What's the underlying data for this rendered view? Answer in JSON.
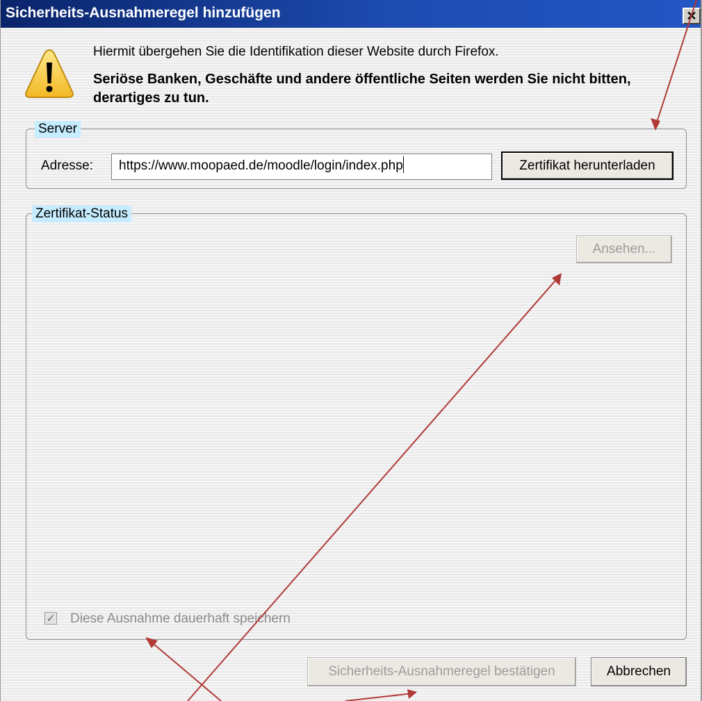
{
  "window": {
    "title": "Sicherheits-Ausnahmeregel hinzufügen",
    "close_glyph": "✕"
  },
  "warning": {
    "icon": "warning-icon",
    "line1": "Hiermit übergehen Sie die Identifikation dieser Website durch Firefox.",
    "line2": "Seriöse Banken, Geschäfte und andere öffentliche Seiten werden Sie nicht bitten, derartiges zu tun."
  },
  "server": {
    "legend": "Server",
    "address_label": "Adresse:",
    "address_value": "https://www.moopaed.de/moodle/login/index.php",
    "download_button": "Zertifikat herunterladen"
  },
  "status": {
    "legend": "Zertifikat-Status",
    "view_button": "Ansehen...",
    "permanent_checkbox_label": "Diese Ausnahme dauerhaft speichern",
    "permanent_checked": true
  },
  "footer": {
    "confirm_button": "Sicherheits-Ausnahmeregel bestätigen",
    "cancel_button": "Abbrechen"
  },
  "annotations": {
    "arrow_color": "#b03a36"
  },
  "colors": {
    "titlebar": "#0a246a",
    "legend_highlight": "#c6ecff",
    "disabled_text": "#9c9c9c"
  }
}
